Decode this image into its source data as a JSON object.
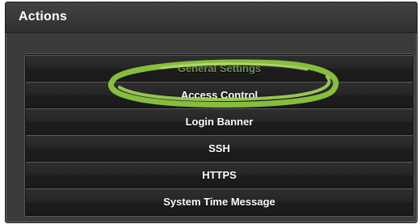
{
  "panel": {
    "title": "Actions"
  },
  "actions": [
    {
      "label": "General Settings"
    },
    {
      "label": "Access Control"
    },
    {
      "label": "Login Banner"
    },
    {
      "label": "SSH"
    },
    {
      "label": "HTTPS"
    },
    {
      "label": "System Time Message"
    }
  ],
  "colors": {
    "panel_bg": "#3b3b3b",
    "button_bg": "#1f1f1f",
    "highlight": "#8cc63f"
  }
}
